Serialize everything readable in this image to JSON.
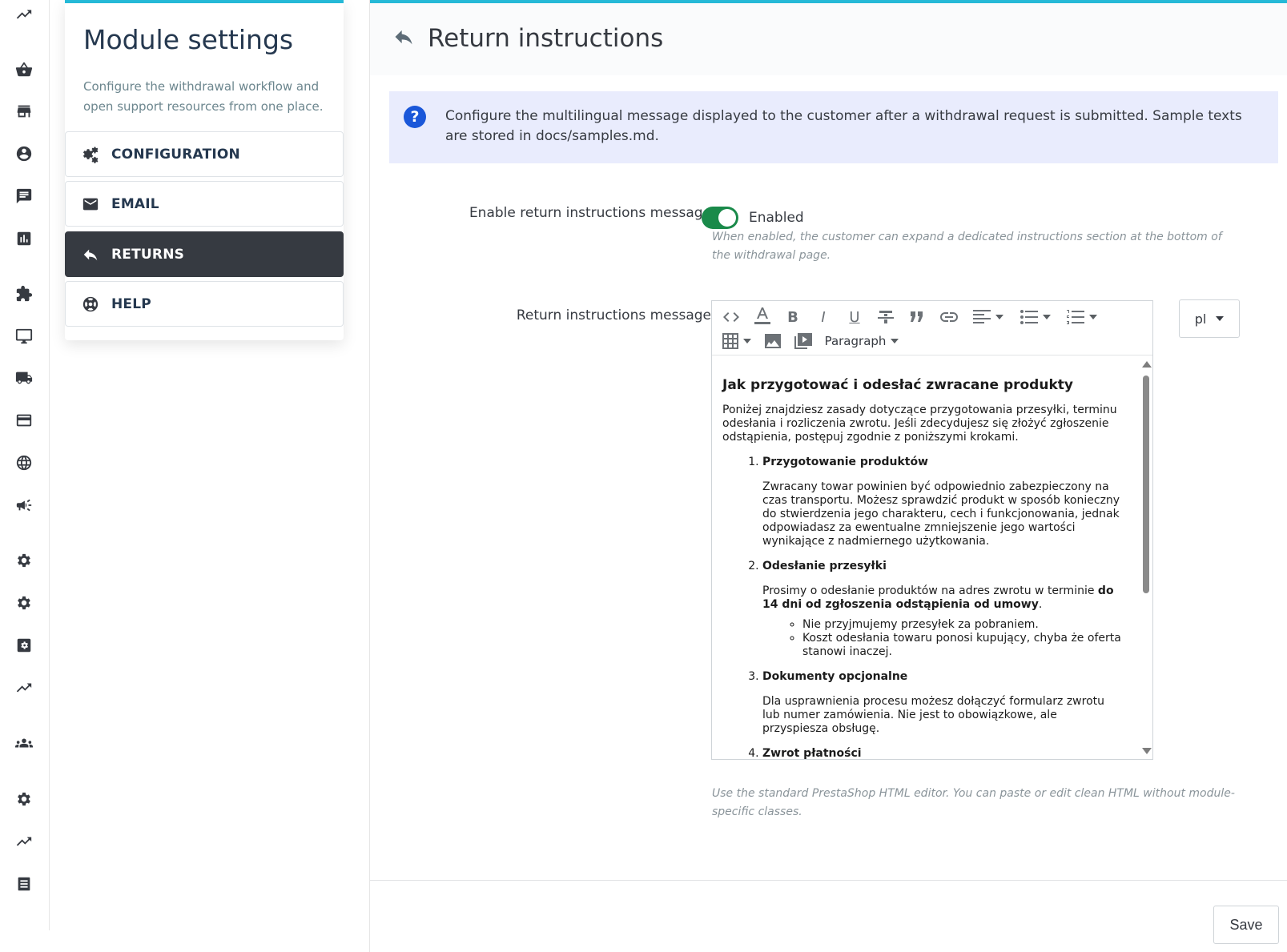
{
  "rail": {
    "icons": [
      "trending-up-icon",
      "basket-icon",
      "store-icon",
      "account-icon",
      "chat-icon",
      "bar-chart-icon",
      "puzzle-icon",
      "desktop-icon",
      "truck-icon",
      "credit-card-icon",
      "globe-icon",
      "megaphone-icon",
      "gear-icon",
      "gear-icon",
      "settings-box-icon",
      "trending-up-icon",
      "group-icon",
      "gear-icon",
      "trending-up-icon",
      "receipt-icon"
    ]
  },
  "panel": {
    "title": "Module settings",
    "description": "Configure the withdrawal workflow and open support resources from one place.",
    "nav": [
      {
        "label": "CONFIGURATION",
        "icon": "gears-icon"
      },
      {
        "label": "EMAIL",
        "icon": "envelope-icon"
      },
      {
        "label": "RETURNS",
        "icon": "reply-icon",
        "active": true
      },
      {
        "label": "HELP",
        "icon": "lifebuoy-icon"
      }
    ]
  },
  "main": {
    "title": "Return instructions",
    "title_icon": "reply-icon",
    "alert": "Configure the multilingual message displayed to the customer after a withdrawal request is submitted. Sample texts are stored in docs/samples.md.",
    "enable_label": "Enable return instructions message",
    "enable_state": "Enabled",
    "enable_on": true,
    "enable_help": "When enabled, the customer can expand a dedicated instructions section at the bottom of the withdrawal page.",
    "message_label": "Return instructions message",
    "editor": {
      "format_select": "Paragraph",
      "heading": "Jak przygotować i odesłać zwracane produkty",
      "intro": "Poniżej znajdziesz zasady dotyczące przygotowania przesyłki, terminu odesłania i rozliczenia zwrotu. Jeśli zdecydujesz się złożyć zgłoszenie odstąpienia, postępuj zgodnie z poniższymi krokami.",
      "step1_title": "Przygotowanie produktów",
      "step1_text": "Zwracany towar powinien być odpowiednio zabezpieczony na czas transportu. Możesz sprawdzić produkt w sposób konieczny do stwierdzenia jego charakteru, cech i funkcjonowania, jednak odpowiadasz za ewentualne zmniejszenie jego wartości wynikające z nadmiernego użytkowania.",
      "step2_title": "Odesłanie przesyłki",
      "step2_text": "Prosimy o odesłanie produktów na adres zwrotu w terminie ",
      "step2_bold": "do 14 dni od zgłoszenia odstąpienia od umowy",
      "step2_end": ".",
      "step2_bullet1": "Nie przyjmujemy przesyłek za pobraniem.",
      "step2_bullet2": "Koszt odesłania towaru ponosi kupujący, chyba że oferta stanowi inaczej.",
      "step3_title": "Dokumenty opcjonalne",
      "step3_text": "Dla usprawnienia procesu możesz dołączyć formularz zwrotu lub numer zamówienia. Nie jest to obowiązkowe, ale przyspiesza obsługę.",
      "step4_title": "Zwrot płatności"
    },
    "language": "pl",
    "editor_help": "Use the standard PrestaShop HTML editor. You can paste or edit clean HTML without module-specific classes.",
    "save_label": "Save"
  },
  "colors": {
    "accent": "#25b9d7",
    "dark": "#363a41",
    "toggle_on": "#1a8a4a",
    "alert_bg": "#e9ecfd",
    "alert_icon": "#1a57d9"
  }
}
